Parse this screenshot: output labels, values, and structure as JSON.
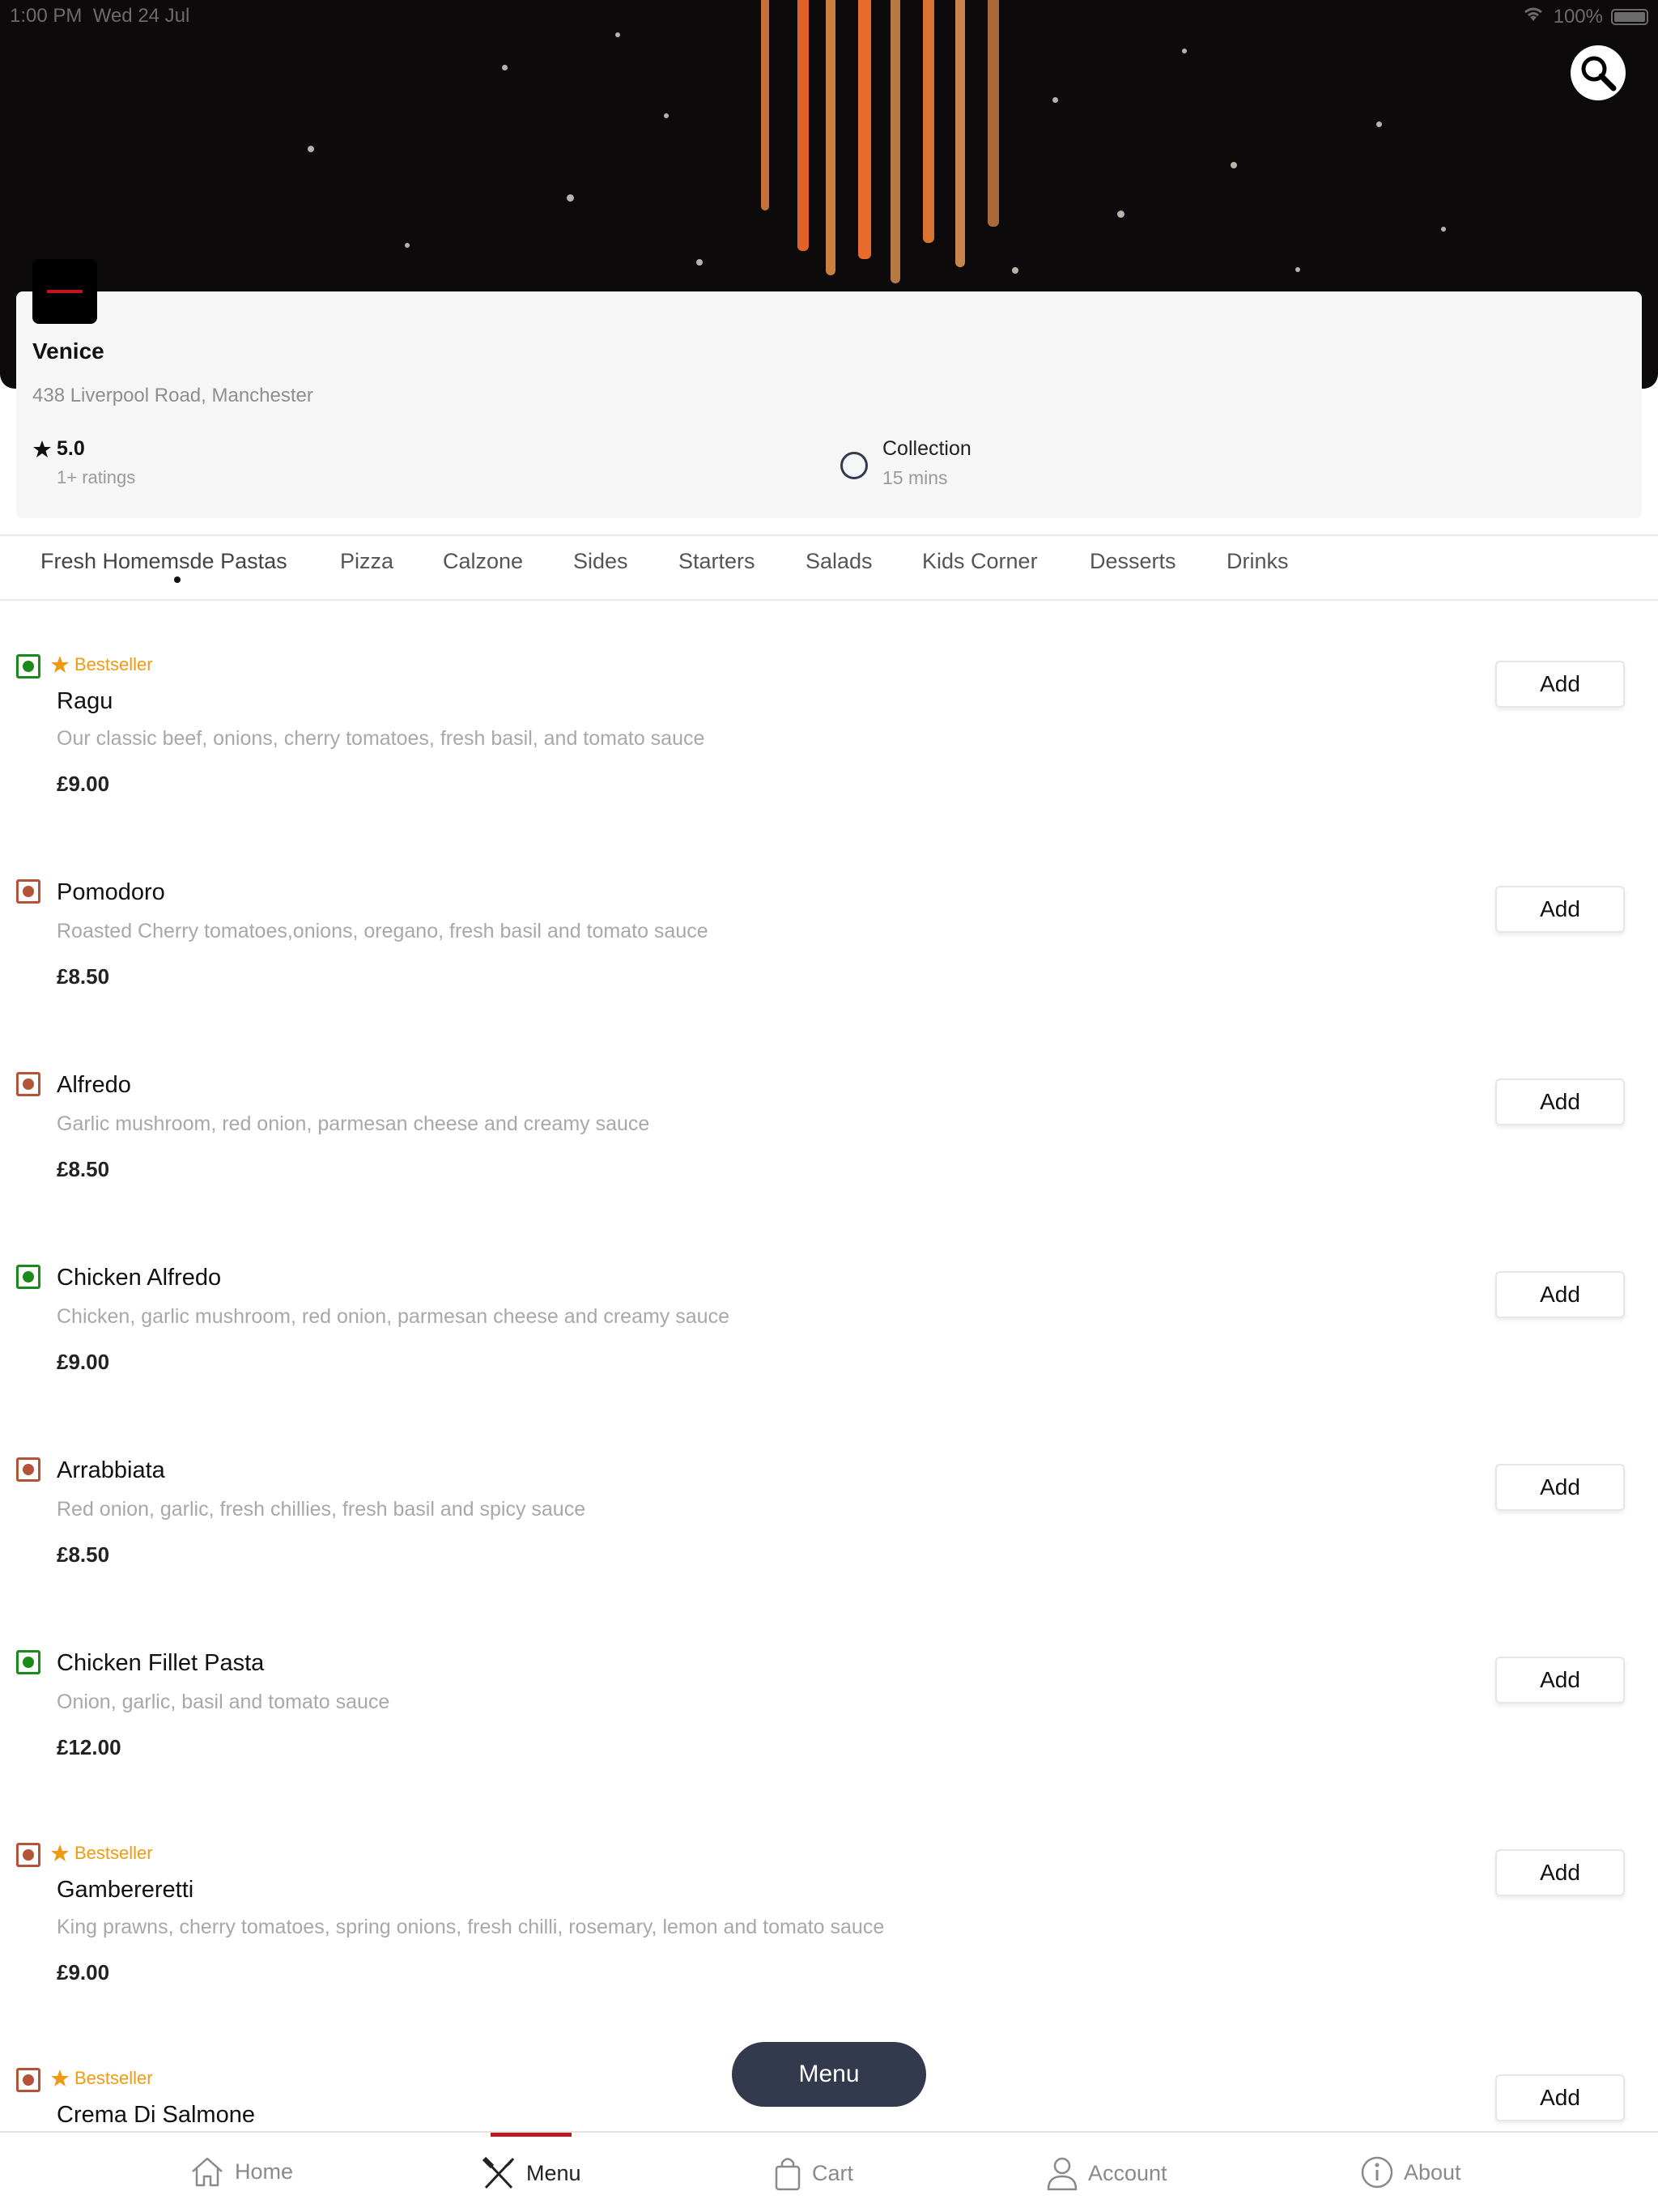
{
  "status_bar": {
    "time": "1:00 PM",
    "date": "Wed 24 Jul",
    "battery": "100%"
  },
  "restaurant": {
    "name": "Venice",
    "address": "438 Liverpool Road, Manchester",
    "rating": "5.0",
    "rating_count": "1+ ratings",
    "mode": "Collection",
    "time": "15 mins"
  },
  "categories": [
    "Fresh Homemsde Pastas",
    "Pizza",
    "Calzone",
    "Sides",
    "Starters",
    "Salads",
    "Kids Corner",
    "Desserts",
    "Drinks"
  ],
  "active_category": "Fresh Homemsde Pastas",
  "add_label": "Add",
  "bestseller_label": "Bestseller",
  "items": [
    {
      "name": "Ragu",
      "desc": "Our classic beef, onions, cherry tomatoes, fresh basil, and tomato sauce",
      "price": "£9.00",
      "diet": "green",
      "bestseller": true
    },
    {
      "name": "Pomodoro",
      "desc": "Roasted Cherry tomatoes,onions, oregano, fresh basil and tomato sauce",
      "price": "£8.50",
      "diet": "red",
      "bestseller": false
    },
    {
      "name": "Alfredo",
      "desc": "Garlic mushroom, red onion, parmesan cheese and creamy sauce",
      "price": "£8.50",
      "diet": "red",
      "bestseller": false
    },
    {
      "name": "Chicken Alfredo",
      "desc": "Chicken, garlic mushroom, red onion, parmesan cheese and creamy sauce",
      "price": "£9.00",
      "diet": "green",
      "bestseller": false
    },
    {
      "name": "Arrabbiata",
      "desc": "Red onion, garlic, fresh chillies, fresh basil and spicy sauce",
      "price": "£8.50",
      "diet": "red",
      "bestseller": false
    },
    {
      "name": "Chicken Fillet Pasta",
      "desc": "Onion, garlic, basil and tomato sauce",
      "price": "£12.00",
      "diet": "green",
      "bestseller": false
    },
    {
      "name": "Gambereretti",
      "desc": "King prawns, cherry tomatoes, spring onions, fresh chilli, rosemary, lemon and tomato sauce",
      "price": "£9.00",
      "diet": "red",
      "bestseller": true
    },
    {
      "name": "Crema Di Salmone",
      "desc": "",
      "price": "",
      "diet": "red",
      "bestseller": true
    }
  ],
  "floating_menu_label": "Menu",
  "nav": [
    {
      "label": "Home",
      "icon": "home-icon"
    },
    {
      "label": "Menu",
      "icon": "utensils-icon"
    },
    {
      "label": "Cart",
      "icon": "bag-icon"
    },
    {
      "label": "Account",
      "icon": "user-icon"
    },
    {
      "label": "About",
      "icon": "info-icon"
    }
  ],
  "colors": {
    "accent": "#c4161c",
    "navy": "#333a4e",
    "bestseller": "#f09a12",
    "veg": "#1a8a1a",
    "nonveg": "#b3533a"
  }
}
